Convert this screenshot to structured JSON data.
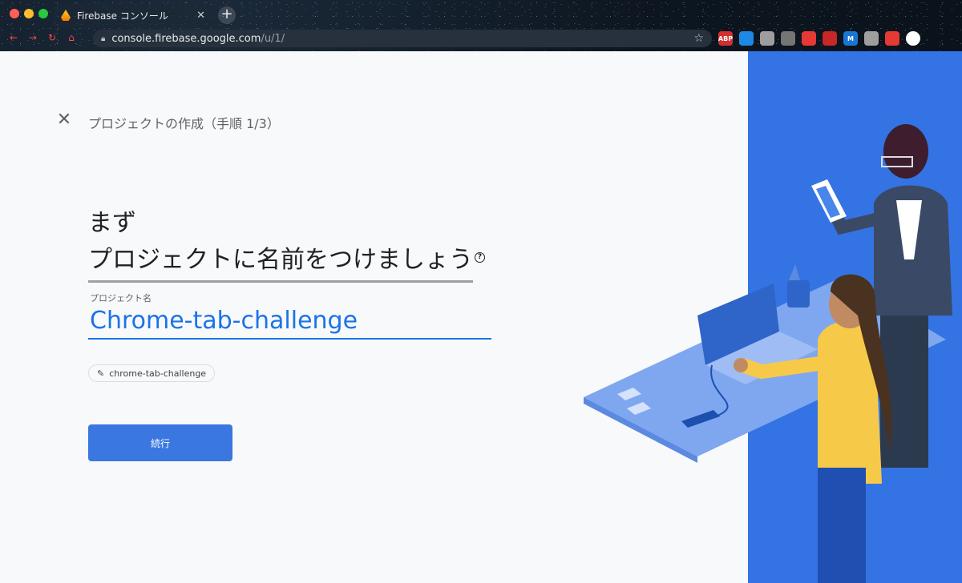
{
  "browser": {
    "tab_title": "Firebase コンソール",
    "tab_close": "✕",
    "new_tab": "+",
    "url_host": "console.firebase.google.com",
    "url_path": "/u/1/",
    "extensions": [
      {
        "label": "ABP",
        "color": "#d32f2f"
      },
      {
        "label": "",
        "color": "#1e88e5"
      },
      {
        "label": "",
        "color": "#9e9e9e"
      },
      {
        "label": "",
        "color": "#757575"
      },
      {
        "label": "",
        "color": "#e53935"
      },
      {
        "label": "",
        "color": "#c62828"
      },
      {
        "label": "M",
        "color": "#1976d2"
      },
      {
        "label": "",
        "color": "#9e9e9e"
      },
      {
        "label": "",
        "color": "#e53935"
      }
    ]
  },
  "page": {
    "step_title": "プロジェクトの作成（手順 1/3）",
    "heading_line1": "まず",
    "heading_line2": "プロジェクトに名前をつけましょう",
    "help_icon": "?",
    "field_label": "プロジェクト名",
    "project_name": "Chrome-tab-challenge",
    "project_id_chip": "chrome-tab-challenge",
    "continue_label": "続行"
  },
  "colors": {
    "accent": "#1a73e8",
    "button": "#3b77e0",
    "illustration_blue": "#3473e3"
  }
}
